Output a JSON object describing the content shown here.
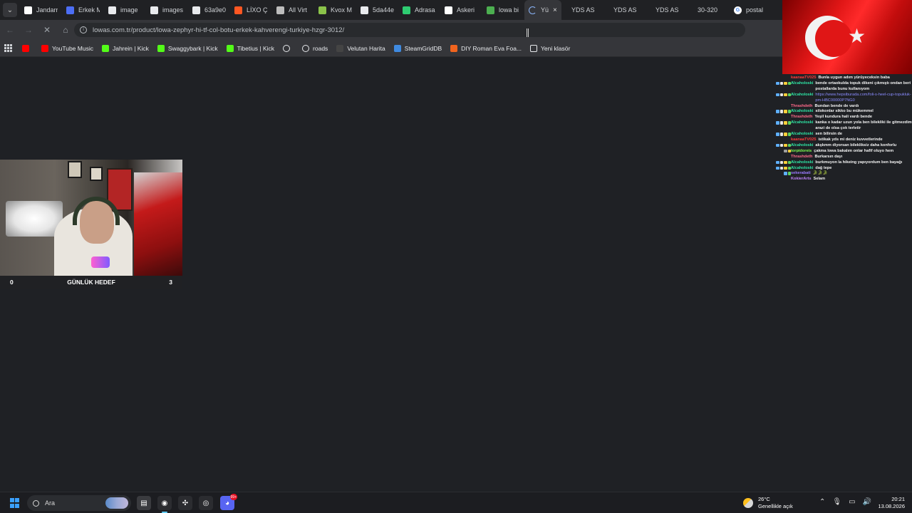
{
  "browser": {
    "tabs": [
      {
        "label": "Jandarr",
        "icon": "jandarma-favicon-icon",
        "color": "#ffffff"
      },
      {
        "label": "Erkek M",
        "icon": "quill-favicon-icon",
        "color": "#4c6ef5"
      },
      {
        "label": "image",
        "icon": "globe-favicon-icon",
        "color": "#e8eaed"
      },
      {
        "label": "images",
        "icon": "globe-favicon-icon",
        "color": "#e8eaed"
      },
      {
        "label": "63a9e0",
        "icon": "globe-favicon-icon",
        "color": "#e8eaed"
      },
      {
        "label": "LİXO Ç",
        "icon": "lixo-favicon-icon",
        "color": "#ff5722"
      },
      {
        "label": "All Virt",
        "icon": "doc-favicon-icon",
        "color": "#bdbdbd"
      },
      {
        "label": "Kvox M",
        "icon": "kvox-favicon-icon",
        "color": "#8bc34a"
      },
      {
        "label": "5da44e",
        "icon": "globe-favicon-icon",
        "color": "#e8eaed"
      },
      {
        "label": "Adrasa",
        "icon": "m-favicon-icon",
        "color": "#2ecc71"
      },
      {
        "label": "Askeri",
        "icon": "askeri-favicon-icon",
        "color": "#ffffff"
      },
      {
        "label": "lowa bi",
        "icon": "lowa-favicon-icon",
        "color": "#4caf50"
      }
    ],
    "active_tab": {
      "label": "Yü",
      "close": "×"
    },
    "more_tabs": [
      "YDS AS",
      "YDS AS",
      "YDS AS",
      "30-320"
    ],
    "last_tab": {
      "label": "postal",
      "icon": "google-favicon-icon"
    },
    "url": "lowas.com.tr/product/lowa-zephyr-hi-tf-col-botu-erkek-kahverengi-turkiye-hzgr-3012/",
    "bookmarks": [
      {
        "label": "",
        "icon": "youtube-icon",
        "color": "#ff0000"
      },
      {
        "label": "YouTube Music",
        "icon": "youtube-music-icon",
        "color": "#ff0000"
      },
      {
        "label": "Jahrein | Kick",
        "icon": "kick-icon",
        "color": "#53fc18"
      },
      {
        "label": "Swaggybark | Kick",
        "icon": "kick-icon",
        "color": "#53fc18"
      },
      {
        "label": "Tibetius | Kick",
        "icon": "kick-icon",
        "color": "#53fc18"
      },
      {
        "label": "",
        "icon": "globe-icon",
        "color": "#e8eaed"
      },
      {
        "label": "roads",
        "icon": "roads-icon",
        "color": "#e8eaed"
      },
      {
        "label": "Velutan Harita",
        "icon": "velutan-icon",
        "color": "#444444"
      },
      {
        "label": "SteamGridDB",
        "icon": "steamgriddb-icon",
        "color": "#3f8ae0"
      },
      {
        "label": "DIY Roman Eva Foa...",
        "icon": "etsy-icon",
        "color": "#f1641e"
      },
      {
        "label": "Yeni klasör",
        "icon": "folder-icon",
        "color": "#e8eaed"
      }
    ]
  },
  "overlay": {
    "goal": {
      "current": "0",
      "label": "GÜNLÜK HEDEF",
      "target": "3"
    }
  },
  "chat": [
    {
      "user": "kaanaaTV025",
      "color": "#ff3b3b",
      "badges": [],
      "msg": "Bunla uygun adım yürüyeceksin baba"
    },
    {
      "user": "Alcaholoski",
      "color": "#2ee6a6",
      "badges": [
        "#5fb0ff",
        "#e8e8e8",
        "#ffcf3a",
        "#5fd35f"
      ],
      "msg": "bende ortaokulda topuk dikeni çıkmıştı ondan beri postallarda bunu kullanıyom"
    },
    {
      "user": "Alcaholoski",
      "color": "#2ee6a6",
      "badges": [
        "#5fb0ff",
        "#e8e8e8",
        "#ffcf3a",
        "#5fd35f"
      ],
      "msg": "https://www.hepsiburada.com/foli-s-heel-cup-topukluk-pm-HBC00000P7NG0",
      "link": true
    },
    {
      "user": "Thrashdeth",
      "color": "#ff6a8a",
      "badges": [],
      "msg": "Bundan bende de vardı"
    },
    {
      "user": "Alcaholoski",
      "color": "#2ee6a6",
      "badges": [
        "#5fb0ff",
        "#e8e8e8",
        "#ffcf3a",
        "#5fd35f"
      ],
      "msg": "silokonlar sikko bu mükemmel"
    },
    {
      "user": "Thrashdeth",
      "color": "#ff6a8a",
      "badges": [],
      "msg": "Yeşil kundura hali vardı bende"
    },
    {
      "user": "Alcaholoski",
      "color": "#2ee6a6",
      "badges": [
        "#5fb0ff",
        "#e8e8e8",
        "#ffcf3a",
        "#5fd35f"
      ],
      "msg": "kanka o kadar uzun yola ben bilekliki ile gitmezdim arazi de olsa çok terletir"
    },
    {
      "user": "Alcaholoski",
      "color": "#2ee6a6",
      "badges": [
        "#5fb0ff",
        "#e8e8e8",
        "#ffcf3a",
        "#5fd35f"
      ],
      "msg": "sen bilirsin de"
    },
    {
      "user": "kaanaaTV025",
      "color": "#ff3b3b",
      "badges": [],
      "msg": "istikak yds mi deniz kuvvetlerinde"
    },
    {
      "user": "Alcaholoski",
      "color": "#2ee6a6",
      "badges": [
        "#5fb0ff",
        "#e8e8e8",
        "#ffcf3a",
        "#5fd35f"
      ],
      "msg": "akşkmm diyorsan bilekliksiz daha konforlu"
    },
    {
      "user": "torpidoreis",
      "color": "#7cff4f",
      "badges": [
        "#a0a0a0",
        "#ffcf3a"
      ],
      "msg": "çakma lowa bakalım onlar hafif oluyo hem"
    },
    {
      "user": "Thrashdeth",
      "color": "#ff6a8a",
      "badges": [],
      "msg": "Burkarsın dayı"
    },
    {
      "user": "Alcaholoski",
      "color": "#2ee6a6",
      "badges": [
        "#5fb0ff",
        "#e8e8e8",
        "#ffcf3a",
        "#5fd35f"
      ],
      "msg": "burkmuyon la hikeing yapıyordum ben bayağı"
    },
    {
      "user": "Alcaholoski",
      "color": "#2ee6a6",
      "badges": [
        "#5fb0ff",
        "#e8e8e8",
        "#ffcf3a",
        "#5fd35f"
      ],
      "msg": "dağ tepe"
    },
    {
      "user": "sekerabati",
      "color": "#9b7bff",
      "badges": [
        "#5fb0ff",
        "#5fd35f"
      ],
      "msg": "🐊🐊🐊"
    },
    {
      "user": "KokierArts",
      "color": "#c084fc",
      "badges": [],
      "msg": "Selam"
    }
  ],
  "taskbar": {
    "search_placeholder": "Ara",
    "apps": [
      {
        "name": "file-manager-icon",
        "color": "#3a3b3f",
        "glyph": "▤"
      },
      {
        "name": "chrome-icon",
        "color": "#2b2c30",
        "glyph": "◉"
      },
      {
        "name": "settings-app-icon",
        "color": "#2b2c30",
        "glyph": "✣"
      },
      {
        "name": "opera-icon",
        "color": "#2b2c30",
        "glyph": "◎"
      },
      {
        "name": "discord-icon",
        "color": "#5865f2",
        "glyph": "◕",
        "badge": "99+"
      }
    ],
    "weather": {
      "temp": "26°C",
      "desc": "Genellikle açık"
    },
    "time": "20:21",
    "date": "13.08.2026"
  }
}
